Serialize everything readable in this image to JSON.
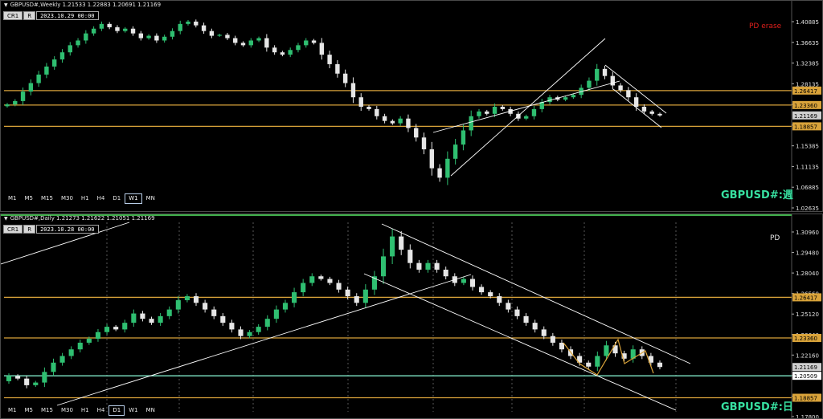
{
  "colors": {
    "bull": "#2fbf71",
    "bear": "#e6e6e6",
    "level": "#d9a33a",
    "level_green": "#7fe8c8",
    "channel": "#ffffff",
    "zigzag": "#d9a33a",
    "label": "#37e0a0",
    "pd_red": "#e0201c",
    "grid": "#6e6e6e",
    "price_tag_bg": "#d9a33a",
    "current_tag_bg": "#cfcfcf"
  },
  "top": {
    "header": "GBPUSD#,Weekly  1.21533 1.22883 1.20691 1.21169",
    "cr_labels": [
      "CR1",
      "R"
    ],
    "date": "2023.10.29 00:00",
    "timeframes": [
      "M1",
      "M5",
      "M15",
      "M30",
      "H1",
      "H4",
      "D1",
      "W1",
      "MN"
    ],
    "active_tf": "W1",
    "symbol_label": "GBPUSD#:週",
    "note": "PD erase",
    "price_axis": [
      "1.40885",
      "1.36635",
      "1.32385",
      "1.28135",
      "1.23885",
      "1.19635",
      "1.15385",
      "1.11135",
      "1.06885",
      "1.02635"
    ],
    "level_tags": [
      "1.26417",
      "1.23360",
      "1.18857"
    ],
    "current_tag": "1.21169"
  },
  "bottom": {
    "header": "GBPUSD#,Daily  1.21273 1.21622 1.21051 1.21169",
    "cr_labels": [
      "CR1",
      "R"
    ],
    "date": "2023.10.28 00:00",
    "timeframes": [
      "M1",
      "M5",
      "M15",
      "M30",
      "H1",
      "H4",
      "D1",
      "W1",
      "MN"
    ],
    "active_tf": "D1",
    "symbol_label": "GBPUSD#:日",
    "note": "PD",
    "price_axis": [
      "1.30960",
      "1.29480",
      "1.28040",
      "1.26560",
      "1.25120",
      "1.23640",
      "1.22160",
      "1.20720",
      "1.19240",
      "1.17800"
    ],
    "level_tags": [
      "1.26417",
      "1.23360",
      "1.20509",
      "1.18857"
    ],
    "current_tag": "1.21169"
  },
  "chart_data": [
    {
      "type": "candlestick",
      "title": "GBPUSD#,Weekly",
      "ylim": [
        1.02635,
        1.42
      ],
      "levels": [
        1.26417,
        1.2336,
        1.18857
      ],
      "closes": [
        1.235,
        1.242,
        1.262,
        1.28,
        1.298,
        1.315,
        1.33,
        1.345,
        1.36,
        1.37,
        1.385,
        1.395,
        1.405,
        1.398,
        1.39,
        1.395,
        1.385,
        1.375,
        1.38,
        1.37,
        1.378,
        1.39,
        1.405,
        1.41,
        1.402,
        1.39,
        1.38,
        1.382,
        1.375,
        1.365,
        1.36,
        1.37,
        1.375,
        1.355,
        1.345,
        1.34,
        1.35,
        1.36,
        1.37,
        1.365,
        1.34,
        1.32,
        1.3,
        1.28,
        1.25,
        1.23,
        1.225,
        1.21,
        1.2,
        1.195,
        1.205,
        1.185,
        1.165,
        1.14,
        1.1,
        1.08,
        1.12,
        1.15,
        1.18,
        1.21,
        1.22,
        1.215,
        1.23,
        1.225,
        1.215,
        1.205,
        1.21,
        1.225,
        1.24,
        1.25,
        1.245,
        1.25,
        1.255,
        1.27,
        1.285,
        1.31,
        1.295,
        1.275,
        1.265,
        1.25,
        1.23,
        1.22,
        1.215,
        1.2117
      ]
    },
    {
      "type": "candlestick",
      "title": "GBPUSD#,Daily",
      "ylim": [
        1.178,
        1.317
      ],
      "levels": [
        1.26417,
        1.2336,
        1.20509,
        1.18857
      ],
      "closes": [
        1.205,
        1.203,
        1.198,
        1.2,
        1.208,
        1.215,
        1.22,
        1.225,
        1.23,
        1.233,
        1.238,
        1.242,
        1.24,
        1.245,
        1.252,
        1.248,
        1.245,
        1.25,
        1.255,
        1.262,
        1.265,
        1.26,
        1.255,
        1.25,
        1.245,
        1.24,
        1.235,
        1.238,
        1.242,
        1.248,
        1.255,
        1.26,
        1.268,
        1.275,
        1.28,
        1.278,
        1.275,
        1.27,
        1.265,
        1.26,
        1.27,
        1.28,
        1.295,
        1.31,
        1.3,
        1.29,
        1.285,
        1.29,
        1.285,
        1.28,
        1.275,
        1.278,
        1.272,
        1.268,
        1.265,
        1.26,
        1.255,
        1.25,
        1.245,
        1.24,
        1.235,
        1.23,
        1.225,
        1.22,
        1.215,
        1.212,
        1.22,
        1.228,
        1.222,
        1.218,
        1.225,
        1.22,
        1.215,
        1.2117
      ]
    }
  ]
}
